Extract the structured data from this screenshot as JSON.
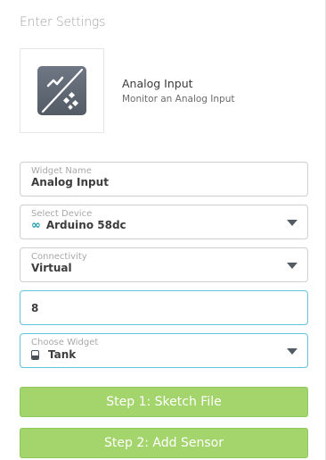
{
  "header": {
    "title": "Enter Settings"
  },
  "widget": {
    "icon": "analog-input-icon",
    "name": "Analog Input",
    "description": "Monitor an Analog Input"
  },
  "form": {
    "widget_name": {
      "label": "Widget Name",
      "value": "Analog Input"
    },
    "device": {
      "label": "Select Device",
      "icon": "arduino-infinity-icon",
      "value": "Arduino 58dc"
    },
    "connectivity": {
      "label": "Connectivity",
      "value": "Virtual"
    },
    "pin": {
      "value": "8"
    },
    "choose_widget": {
      "label": "Choose Widget",
      "icon": "tank-icon",
      "value": "Tank"
    }
  },
  "buttons": {
    "step1": "Step 1: Sketch File",
    "step2": "Step 2: Add Sensor"
  },
  "colors": {
    "button_green": "#a3d56c",
    "focus_border": "#5fc4d8",
    "arduino_teal": "#1a9ba8",
    "icon_gray": "#5f6772"
  }
}
